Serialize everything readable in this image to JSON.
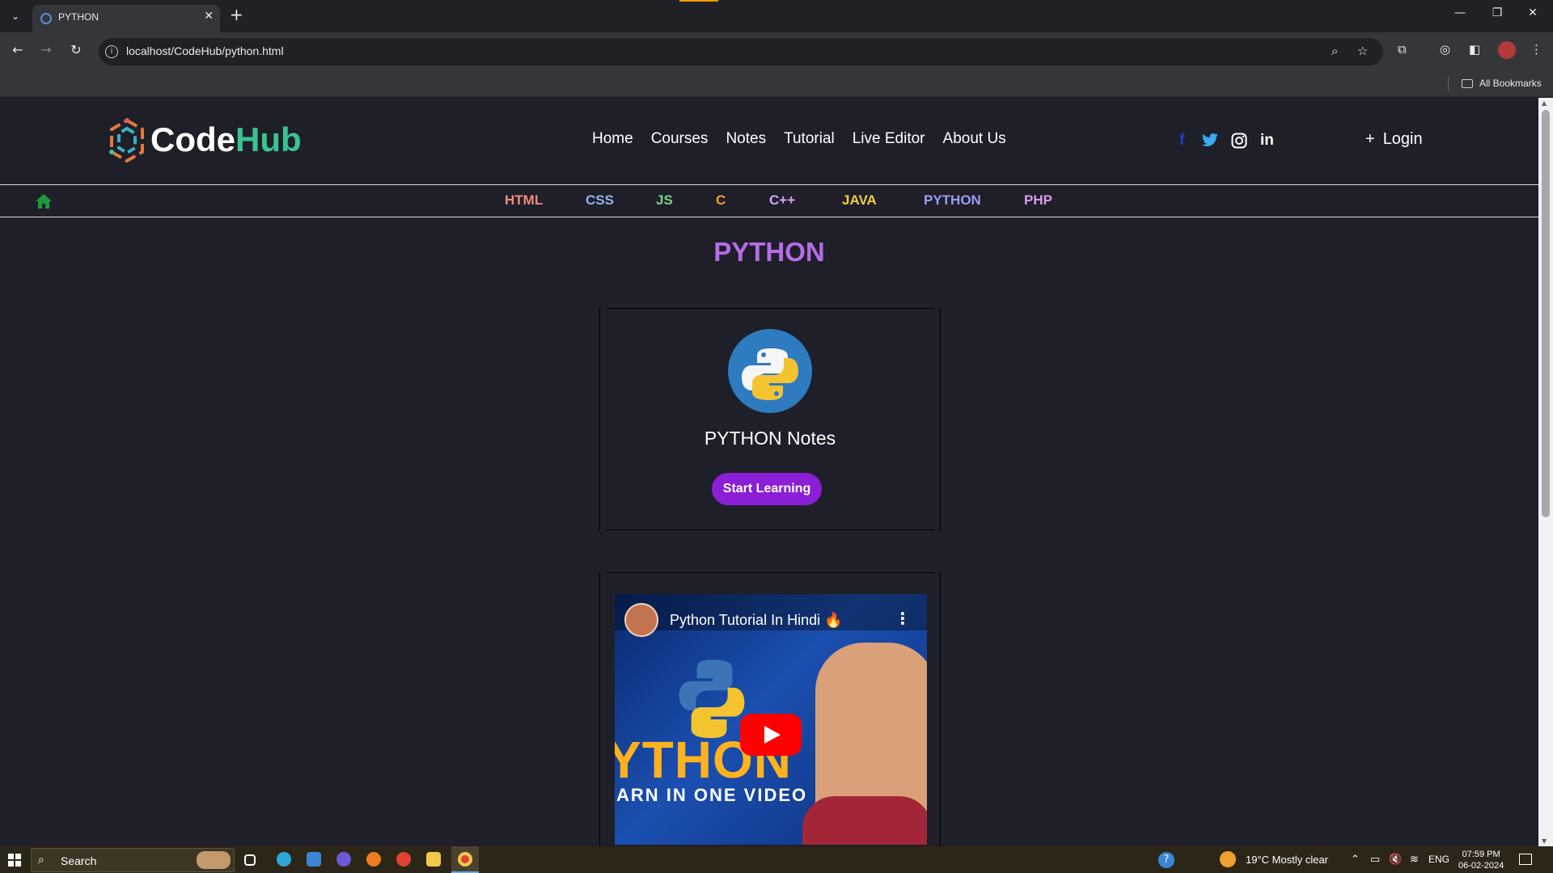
{
  "browser": {
    "tab_title": "PYTHON",
    "url": "localhost/CodeHub/python.html",
    "bookmarks_label": "All Bookmarks"
  },
  "site": {
    "logo_code": "Code",
    "logo_hub": "Hub",
    "nav": [
      "Home",
      "Courses",
      "Notes",
      "Tutorial",
      "Live Editor",
      "About Us"
    ],
    "login_label": "Login",
    "social": [
      "facebook-icon",
      "twitter-icon",
      "instagram-icon",
      "linkedin-icon"
    ]
  },
  "languages": [
    {
      "label": "HTML",
      "color": "#f08a7a"
    },
    {
      "label": "CSS",
      "color": "#8fb3e8"
    },
    {
      "label": "JS",
      "color": "#7ed07e"
    },
    {
      "label": "C",
      "color": "#f0a030"
    },
    {
      "label": "C++",
      "color": "#d9a3f0"
    },
    {
      "label": "JAVA",
      "color": "#f0d040"
    },
    {
      "label": "PYTHON",
      "color": "#9a9cf5"
    },
    {
      "label": "PHP",
      "color": "#d89ae8"
    }
  ],
  "page_title": "PYTHON",
  "notes_card": {
    "title": "PYTHON Notes",
    "button": "Start Learning"
  },
  "video": {
    "title": "Python Tutorial In Hindi 🔥",
    "thumb_big": "YTHON",
    "thumb_sub": "ARN IN ONE VIDEO"
  },
  "taskbar": {
    "search_placeholder": "Search",
    "weather": "19°C  Mostly clear",
    "lang": "ENG",
    "time": "07:59 PM",
    "date": "06-02-2024"
  }
}
